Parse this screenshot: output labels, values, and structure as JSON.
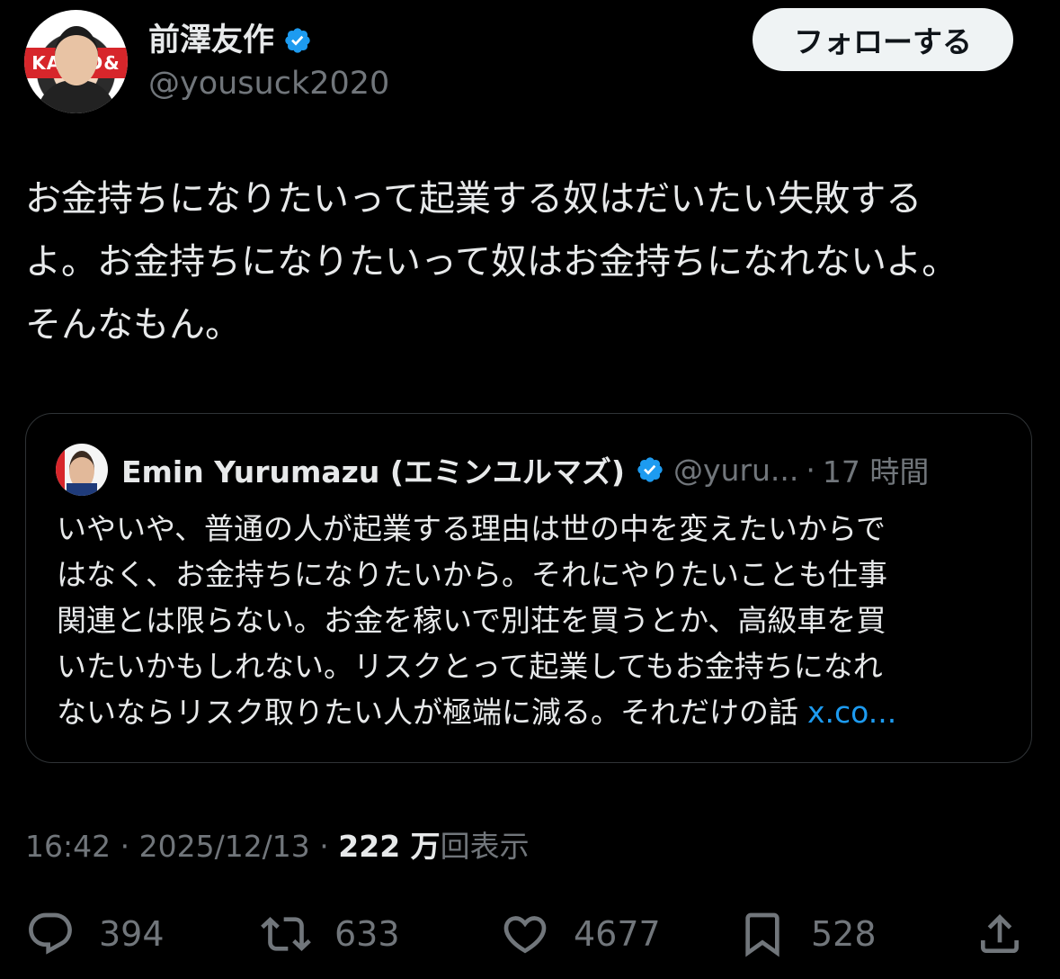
{
  "author": {
    "display_name": "前澤友作",
    "handle": "@yousuck2020",
    "avatar_banner": "KA・ID&"
  },
  "follow_button": {
    "label": "フォローする"
  },
  "tweet": {
    "lines": [
      "お金持ちになりたいって起業する奴はだいたい失敗する",
      "よ。お金持ちになりたいって奴はお金持ちになれないよ。",
      "そんなもん。"
    ]
  },
  "quote": {
    "name": "Emin Yurumazu (エミンユルマズ)",
    "handle": "@yuru...",
    "separator": "·",
    "time": "17 時間",
    "lines": [
      "いやいや、普通の人が起業する理由は世の中を変えたいからで",
      "はなく、お金持ちになりたいから。それにやりたいことも仕事",
      "関連とは限らない。お金を稼いで別荘を買うとか、高級車を買",
      "いたいかもしれない。リスクとって起業してもお金持ちになれ",
      "ないならリスク取りたい人が極端に減る。それだけの話"
    ],
    "link": "x.co..."
  },
  "meta": {
    "time": "16:42",
    "sep1": " · ",
    "date": "2025/12/13",
    "sep2": " · ",
    "views_count": "222 万",
    "views_label": "回表示"
  },
  "actions": {
    "reply_count": "394",
    "repost_count": "633",
    "like_count": "4677",
    "bookmark_count": "528"
  },
  "icons": {
    "verified": "verified-badge-icon",
    "reply": "reply-bubble-icon",
    "repost": "repost-arrows-icon",
    "like": "heart-icon",
    "bookmark": "bookmark-icon",
    "share": "share-upload-icon"
  },
  "colors": {
    "background": "#000000",
    "text": "#e7e9ea",
    "secondary": "#71767b",
    "accent": "#1d9bf0",
    "follow_bg": "#eff3f4",
    "border": "#2f3336"
  }
}
